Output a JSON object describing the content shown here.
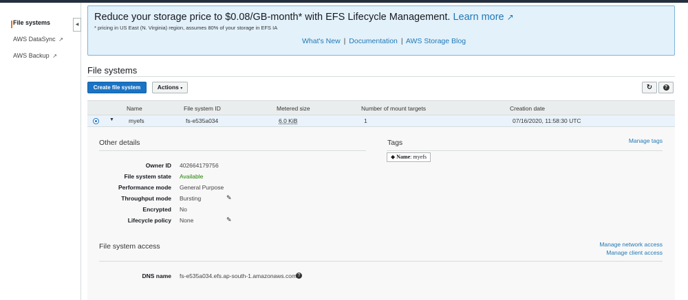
{
  "sidebar": {
    "items": [
      {
        "label": "File systems",
        "active": true,
        "external": false
      },
      {
        "label": "AWS DataSync",
        "active": false,
        "external": true
      },
      {
        "label": "AWS Backup",
        "active": false,
        "external": true
      }
    ],
    "collapse_icon": "chevron-left-icon"
  },
  "banner": {
    "title": "Reduce your storage price to $0.08/GB-month* with EFS Lifecycle Management.",
    "learn_more": "Learn more",
    "note": "* pricing in US East (N. Virginia) region, assumes 80% of your storage in EFS IA",
    "links": [
      "What's New",
      "Documentation",
      "AWS Storage Blog"
    ],
    "separator": "|"
  },
  "page": {
    "title": "File systems",
    "create_button": "Create file system",
    "actions_button": "Actions",
    "refresh_icon": "refresh-icon",
    "help_icon": "help-icon"
  },
  "table": {
    "columns": [
      "Name",
      "File system ID",
      "Metered size",
      "Number of mount targets",
      "Creation date"
    ],
    "rows": [
      {
        "selected": true,
        "expanded": true,
        "name": "myefs",
        "id": "fs-e535a034",
        "size": "6.0 KiB",
        "mount_targets": "1",
        "created": "07/16/2020, 11:58:30 UTC"
      }
    ]
  },
  "details": {
    "other_details_title": "Other details",
    "fields": [
      {
        "label": "Owner ID",
        "value": "402664179756",
        "editable": false
      },
      {
        "label": "File system state",
        "value": "Available",
        "editable": false
      },
      {
        "label": "Performance mode",
        "value": "General Purpose",
        "editable": false
      },
      {
        "label": "Throughput mode",
        "value": "Bursting",
        "editable": true
      },
      {
        "label": "Encrypted",
        "value": "No",
        "editable": false
      },
      {
        "label": "Lifecycle policy",
        "value": "None",
        "editable": true
      }
    ],
    "tags_title": "Tags",
    "manage_tags": "Manage tags",
    "tag": {
      "key": "Name",
      "value": "myefs"
    },
    "access_title": "File system access",
    "manage_network_access": "Manage network access",
    "manage_client_access": "Manage client access",
    "dns_label": "DNS name",
    "dns_value": "fs-e535a034.efs.ap-south-1.amazonaws.com"
  },
  "colors": {
    "primary": "#1a73c4",
    "link": "#1f78b4",
    "status_available": "#1d8102",
    "nav_accent": "#ec7211",
    "banner_bg": "#e3f1fb"
  }
}
